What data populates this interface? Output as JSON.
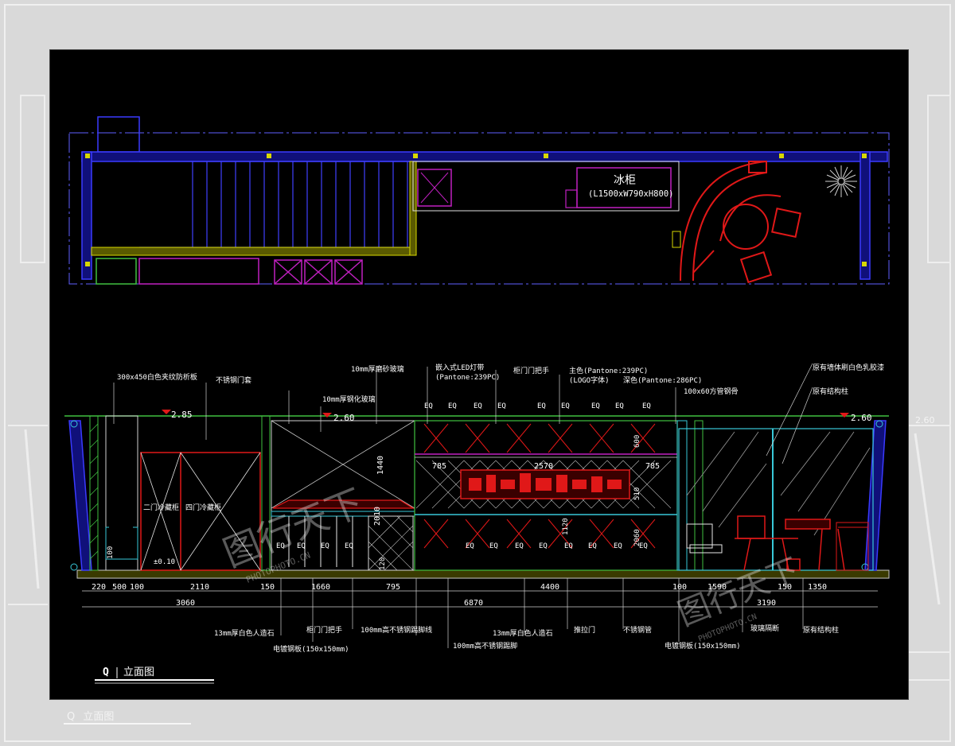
{
  "plan": {
    "fridge_label": "冰柜",
    "fridge_size": "(L1500xW790xH800)"
  },
  "elevation": {
    "title_letter": "Q",
    "title": "立面图",
    "levels": [
      "2.85",
      "2.60",
      "2.60"
    ],
    "floor_level": "±0.10",
    "door_labels": [
      "二门冷藏柜",
      "四门冷藏柜"
    ],
    "shelf_marks": [
      "EQ"
    ],
    "heights": [
      "1440",
      "2010",
      "1120",
      "120",
      "100",
      "600",
      "510",
      "2060"
    ],
    "notes_top": [
      "300x450白色夹纹防析板",
      "不锈钢门套",
      "10mm厚磨砂玻璃",
      "10mm厚钢化玻璃",
      "嵌入式LED灯带",
      "(Pantone:239PC)",
      "柜门门把手",
      "主色(Pantone:239PC)",
      "(LOGO字体)",
      "深色(Pantone:286PC)",
      "100x60方管钢骨",
      "原有墙体刷白色乳胶漆",
      "原有结构柱"
    ],
    "dims_row1": [
      "220",
      "500",
      "100",
      "2110",
      "150",
      "1660",
      "795",
      "4400",
      "100",
      "1590",
      "150",
      "1350"
    ],
    "dims_row2": [
      "3060",
      "6870",
      "3190"
    ],
    "inner_dims": [
      "785",
      "2570",
      "785"
    ],
    "notes_bottom": [
      "13mm厚白色人造石",
      "电镀钢板(150x150mm)",
      "柜门门把手",
      "100mm高不锈钢踢脚线",
      "100mm高不锈钢踢脚",
      "13mm厚白色人造石",
      "推拉门",
      "不锈钢管",
      "电镀钢板(150x150mm)",
      "玻璃隔断",
      "原有结构柱"
    ]
  },
  "watermark": {
    "text": "图行天下",
    "sub": "PHOTOPHOTO.CN"
  },
  "background": {
    "caption_letter": "Q",
    "caption": "立面图",
    "level": "2.60"
  },
  "colors": {
    "canvas": "#000000",
    "page": "#d9d9d9",
    "cad_blue": "#2a2af0",
    "cad_cyan": "#38c8d8",
    "cad_red": "#e01818",
    "cad_magenta": "#c020c0",
    "cad_yellow": "#d8d800",
    "cad_green": "#40c040"
  }
}
